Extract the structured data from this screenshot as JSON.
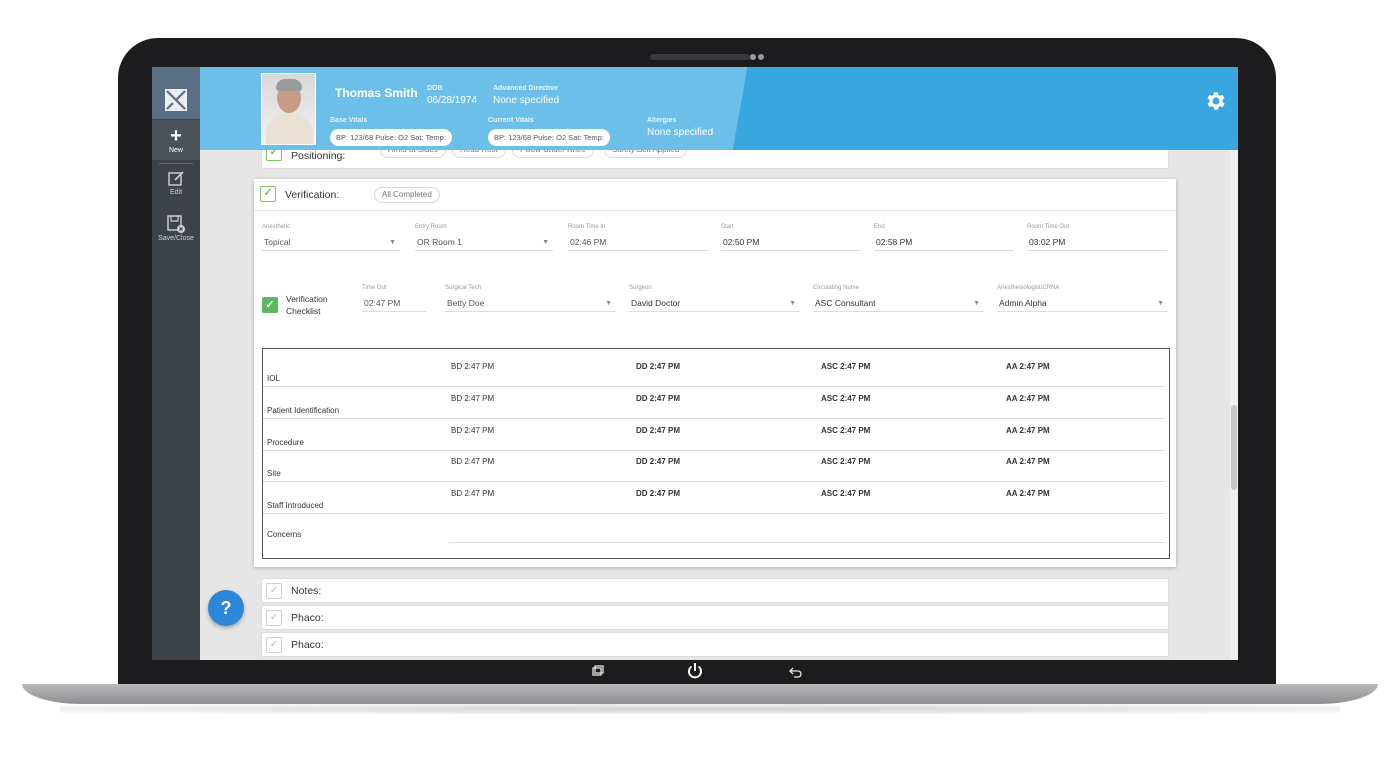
{
  "sidebar": {
    "items": [
      {
        "label": "New",
        "icon": "plus-icon"
      },
      {
        "label": "Edit",
        "icon": "edit-icon"
      },
      {
        "label": "Save/Close",
        "icon": "save-close-icon"
      }
    ]
  },
  "header": {
    "patient_name": "Thomas Smith",
    "dob_label": "DOB",
    "dob": "06/28/1974",
    "advanced_directive_label": "Advanced Directive",
    "advanced_directive": "None specified",
    "base_vitals_label": "Base Vitals",
    "base_vitals": "BP: 123/68 Pulse: O2 Sat: Temp:",
    "current_vitals_label": "Current Vitals",
    "current_vitals": "BP: 123/68 Pulse: O2 Sat: Temp:",
    "allergies_label": "Allergies",
    "allergies": "None specified"
  },
  "positioning": {
    "title": "Positioning:",
    "pills": [
      "Arms at Sides",
      "Head Rest",
      "Pillow Under Knee",
      "Safety Belt Applied"
    ]
  },
  "verification": {
    "title": "Verification:",
    "status": "All Completed",
    "fields_row1": [
      {
        "label": "Anesthetic",
        "value": "Topical",
        "dropdown": true
      },
      {
        "label": "Entry Room",
        "value": "OR Room 1",
        "dropdown": true
      },
      {
        "label": "Room Time In",
        "value": "02:46 PM",
        "dropdown": false
      },
      {
        "label": "Start",
        "value": "02:50 PM",
        "dropdown": false
      },
      {
        "label": "End",
        "value": "02:58 PM",
        "dropdown": false
      },
      {
        "label": "Room Time Out",
        "value": "03:02 PM",
        "dropdown": false
      }
    ],
    "checklist_label_1": "Verification",
    "checklist_label_2": "Checklist",
    "fields_row2": [
      {
        "label": "Time Out",
        "value": "02:47 PM",
        "dropdown": false
      },
      {
        "label": "Surgical Tech",
        "value": "Betty Doe",
        "dropdown": true
      },
      {
        "label": "Surgeon",
        "value": "David Doctor",
        "dropdown": true
      },
      {
        "label": "Circulating Nurse",
        "value": "ASC Consultant",
        "dropdown": true
      },
      {
        "label": "Anesthesiologist/CRNA",
        "value": "Admin Alpha",
        "dropdown": true
      }
    ],
    "table": [
      {
        "name": "IOL",
        "cells": [
          "BD 2:47 PM",
          "DD 2:47 PM",
          "ASC 2:47 PM",
          "AA 2:47 PM"
        ]
      },
      {
        "name": "Patient Identification",
        "cells": [
          "BD 2:47 PM",
          "DD 2:47 PM",
          "ASC 2:47 PM",
          "AA 2:47 PM"
        ]
      },
      {
        "name": "Procedure",
        "cells": [
          "BD 2:47 PM",
          "DD 2:47 PM",
          "ASC 2:47 PM",
          "AA 2:47 PM"
        ]
      },
      {
        "name": "Site",
        "cells": [
          "BD 2:47 PM",
          "DD 2:47 PM",
          "ASC 2:47 PM",
          "AA 2:47 PM"
        ]
      },
      {
        "name": "Staff Introduced",
        "cells": [
          "BD 2:47 PM",
          "DD 2:47 PM",
          "ASC 2:47 PM",
          "AA 2:47 PM"
        ]
      },
      {
        "name": "Concerns",
        "cells": [
          "",
          "",
          "",
          ""
        ]
      }
    ]
  },
  "sections_below": [
    {
      "title": "Notes:"
    },
    {
      "title": "Phaco:"
    },
    {
      "title": "Phaco:"
    }
  ],
  "help": {
    "label": "?"
  },
  "colors": {
    "header_light": "#6cbfe9",
    "header_dark": "#38a7e0",
    "check_green": "#5cb85c",
    "sidebar": "#3d4349"
  }
}
